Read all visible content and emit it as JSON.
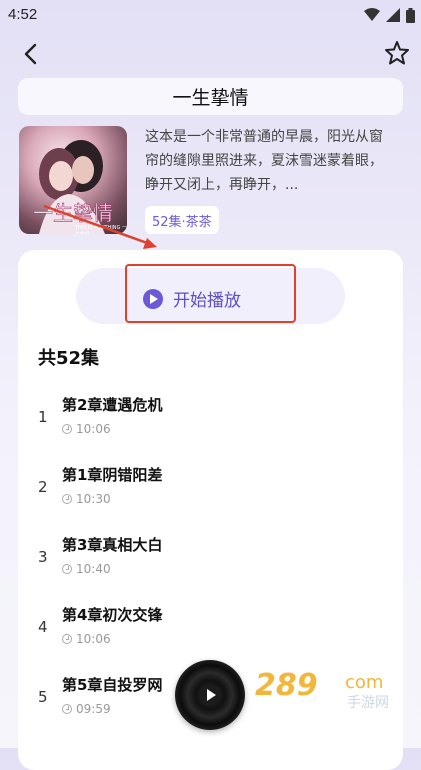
{
  "status": {
    "time": "4:52"
  },
  "title": "一生挚情",
  "cover": {
    "title": "一生挚情",
    "subtitle": "THIS IS ANYTHING 一生挚情"
  },
  "description": "这本是一个非常普通的早晨，阳光从窗帘的缝隙里照进来，夏沫雪迷蒙着眼，睁开又闭上，再睁开，...",
  "tag": "52集·茶茶",
  "play_label": "开始播放",
  "episode_count_label": "共52集",
  "episodes": [
    {
      "num": "1",
      "title": "第2章遭遇危机",
      "duration": "10:06"
    },
    {
      "num": "2",
      "title": "第1章阴错阳差",
      "duration": "10:30"
    },
    {
      "num": "3",
      "title": "第3章真相大白",
      "duration": "10:40"
    },
    {
      "num": "4",
      "title": "第4章初次交锋",
      "duration": "10:06"
    },
    {
      "num": "5",
      "title": "第5章自投罗网",
      "duration": "09:59"
    }
  ],
  "watermark": {
    "number": "289",
    "suffix": "com",
    "text": "手游网"
  },
  "colors": {
    "accent": "#6a5ad8",
    "highlight": "#e0412e"
  },
  "icons": {
    "back": "back-arrow-icon",
    "favorite": "star-outline-icon",
    "play": "play-circle-icon"
  }
}
